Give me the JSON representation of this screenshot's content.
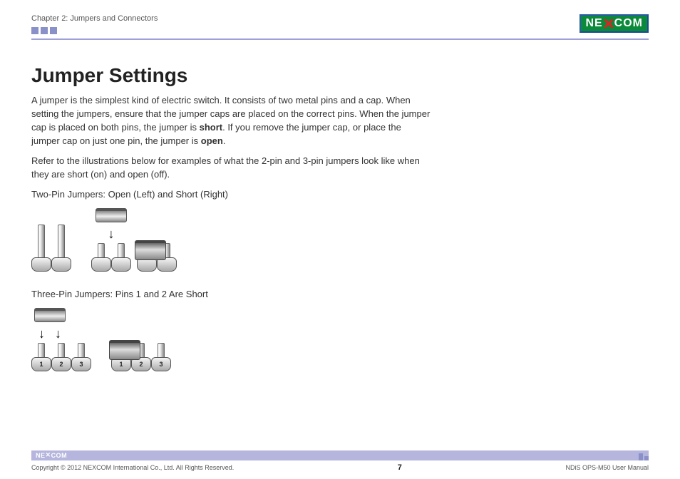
{
  "header": {
    "chapter": "Chapter 2: Jumpers and Connectors",
    "logo_left": "NE",
    "logo_right": "COM"
  },
  "title": "Jumper Settings",
  "para1_a": "A jumper is the simplest kind of electric switch. It consists of two metal pins and a cap. When setting the jumpers, ensure that the jumper caps are placed on the correct pins. When the jumper cap is placed on both pins, the jumper is ",
  "para1_b": "short",
  "para1_c": ". If you remove the jumper cap, or place the jumper cap on just one pin, the jumper is ",
  "para1_d": "open",
  "para1_e": ".",
  "para2": "Refer to the illustrations below for examples of what the 2-pin and 3-pin jumpers look like when they are short (on) and open (off).",
  "caption1": "Two-Pin Jumpers: Open (Left) and Short (Right)",
  "caption2": "Three-Pin Jumpers: Pins 1 and 2 Are Short",
  "pin_labels": {
    "p1": "1",
    "p2": "2",
    "p3": "3"
  },
  "footer": {
    "copyright": "Copyright © 2012 NEXCOM International Co., Ltd. All Rights Reserved.",
    "page": "7",
    "manual": "NDiS OPS-M50 User Manual",
    "logo_left": "NE",
    "logo_right": "COM"
  }
}
